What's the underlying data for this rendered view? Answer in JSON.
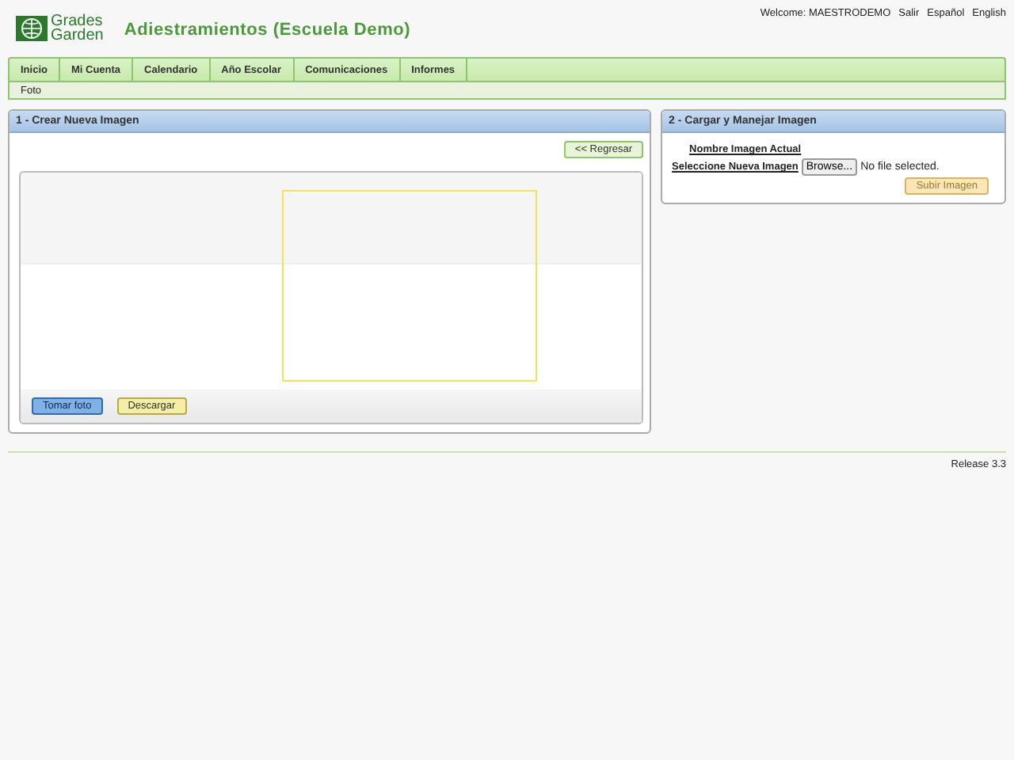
{
  "logo": {
    "line_1": "Grades",
    "line_2": "Garden"
  },
  "title": "Adiestramientos (Escuela Demo)",
  "user_bar": {
    "welcome": "Welcome:",
    "user": "MAESTRODEMO",
    "links": [
      "Salir",
      "Español",
      "English"
    ]
  },
  "nav": [
    "Inicio",
    "Mi Cuenta",
    "Calendario",
    "Año Escolar",
    "Comunicaciones",
    "Informes"
  ],
  "subnav": [
    "Foto"
  ],
  "create_panel": {
    "title": "1 - Crear Nueva Imagen",
    "back_button": "<< Regresar",
    "camera_buttons": [
      {
        "label": "Tomar foto",
        "kind": "primary"
      },
      {
        "label": "Descargar",
        "kind": "warning"
      }
    ]
  },
  "upload_panel": {
    "title": "2 - Cargar y Manejar Imagen",
    "current_label": "Nombre Imagen Actual",
    "select_label": "Seleccione Nueva Imagen",
    "browse_button": "Browse...",
    "file_status": "No file selected.",
    "upload_button": "Subir Imagen"
  },
  "footer": {
    "release": "Release 3.3"
  }
}
